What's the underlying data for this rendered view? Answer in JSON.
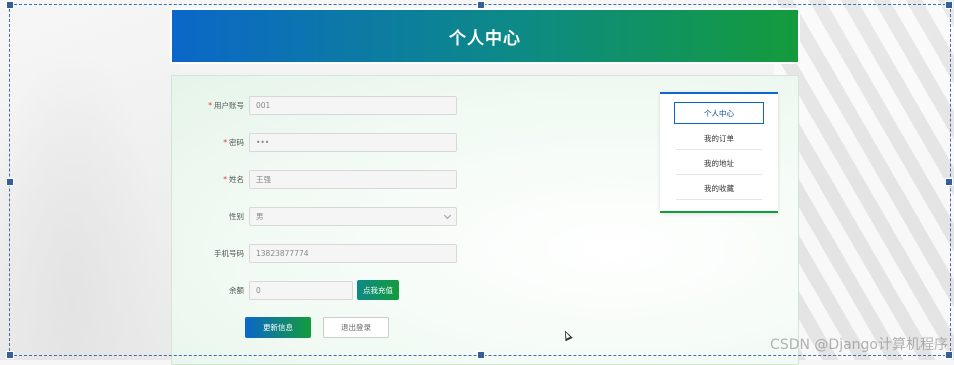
{
  "header": {
    "title": "个人中心"
  },
  "form": {
    "fields": [
      {
        "label": "用户账号",
        "required": true,
        "value": "001"
      },
      {
        "label": "密码",
        "required": true,
        "value": "•••"
      },
      {
        "label": "姓名",
        "required": true,
        "value": "王强"
      },
      {
        "label": "性别",
        "required": false,
        "value": "男"
      },
      {
        "label": "手机号码",
        "required": false,
        "value": "13823877774"
      },
      {
        "label": "余额",
        "required": false,
        "value": "0"
      }
    ],
    "recharge_label": "点我充值",
    "update_label": "更新信息",
    "logout_label": "退出登录"
  },
  "side_menu": {
    "items": [
      {
        "label": "个人中心",
        "active": true
      },
      {
        "label": "我的订单",
        "active": false
      },
      {
        "label": "我的地址",
        "active": false
      },
      {
        "label": "我的收藏",
        "active": false
      }
    ]
  },
  "colors": {
    "header_start": "#0b67c9",
    "header_end": "#149b3c",
    "required": "#e53935"
  },
  "watermark": "CSDN @Django计算机程序"
}
